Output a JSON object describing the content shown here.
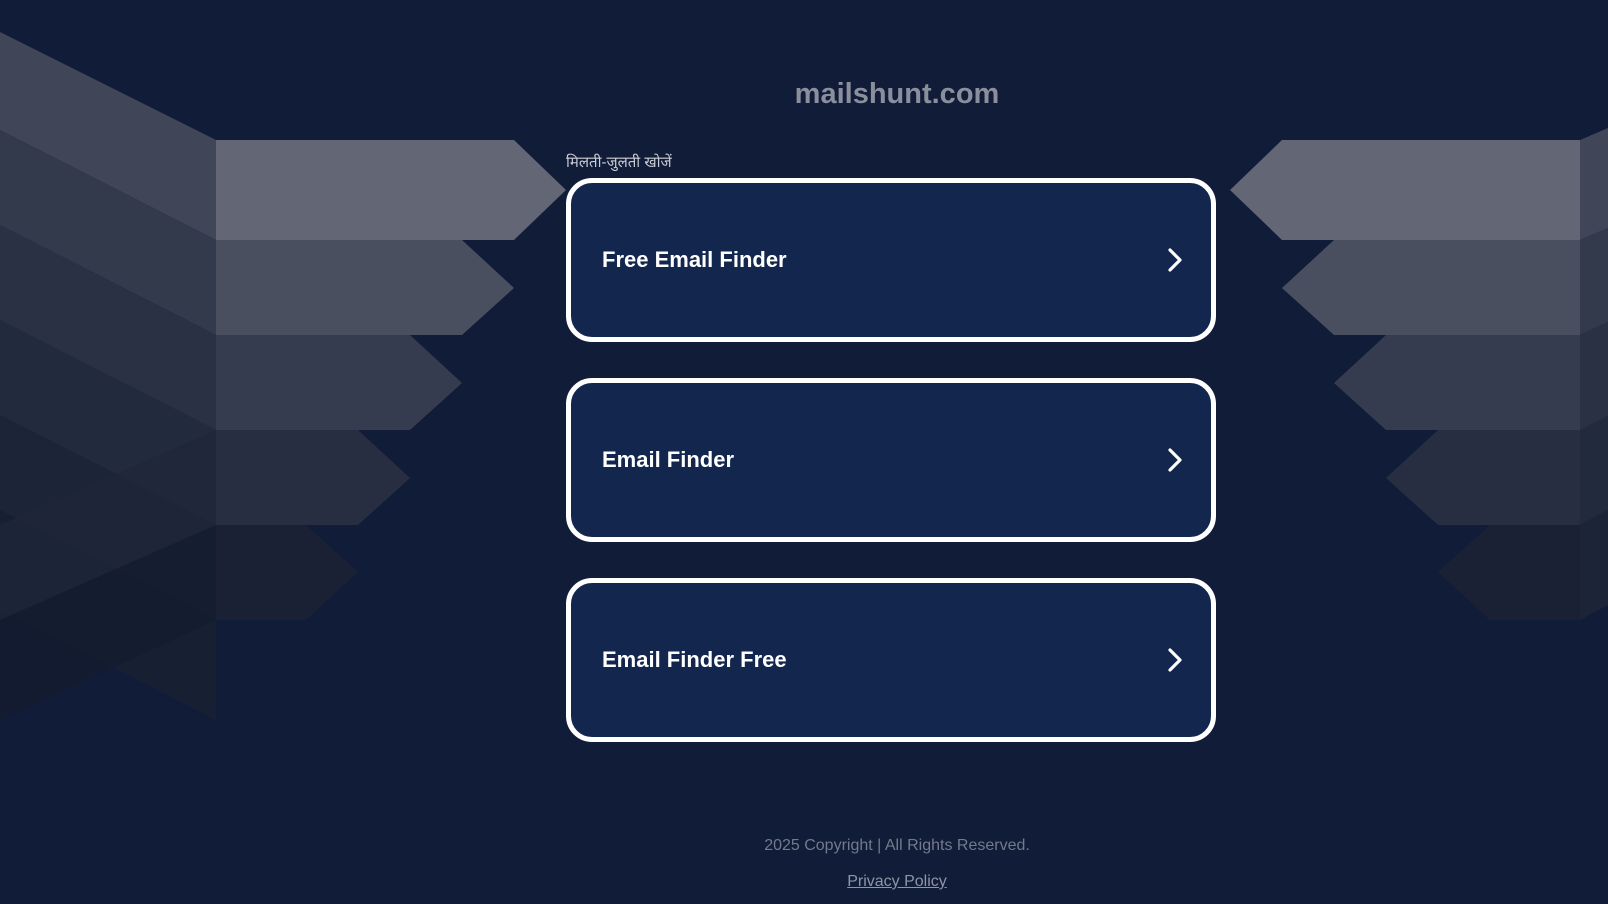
{
  "site": {
    "domain": "mailshunt.com"
  },
  "related": {
    "label": "मिलती-जुलती खोजें"
  },
  "links": [
    {
      "label": "Free Email Finder"
    },
    {
      "label": "Email Finder"
    },
    {
      "label": "Email Finder Free"
    }
  ],
  "footer": {
    "copyright": "2025 Copyright | All Rights Reserved.",
    "privacy_label": "Privacy Policy"
  },
  "icons": {
    "card_arrow": "chevron-right-icon"
  },
  "colors": {
    "background": "#101c38",
    "card_fill": "#13264e",
    "card_border": "#ffffff",
    "title": "#8b8f9d"
  }
}
